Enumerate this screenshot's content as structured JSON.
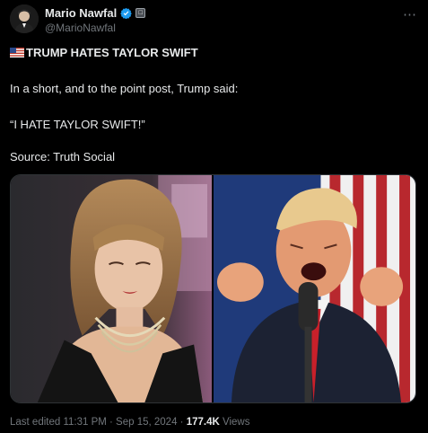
{
  "post": {
    "author": {
      "display_name": "Mario Nawfal",
      "handle": "@MarioNawfal",
      "verified_icon": "verified-badge-icon",
      "affiliation_icon": "affiliate-badge-icon"
    },
    "more_icon": "ellipsis-icon",
    "headline_flag_icon": "us-flag-icon",
    "headline": "TRUMP HATES TAYLOR SWIFT",
    "body_line_1": "In a short, and to the point post, Trump said:",
    "body_line_2": "“I HATE TAYLOR SWIFT!”",
    "body_line_3": "Source: Truth Social",
    "footer": {
      "edited": "Last edited 11:31 PM · Sep 15, 2024 · ",
      "views_count": "177.4K",
      "views_label": " Views"
    }
  },
  "colors": {
    "background": "#000000",
    "text_primary": "#e7e9ea",
    "text_secondary": "#71767b",
    "verified": "#1d9bf0"
  }
}
